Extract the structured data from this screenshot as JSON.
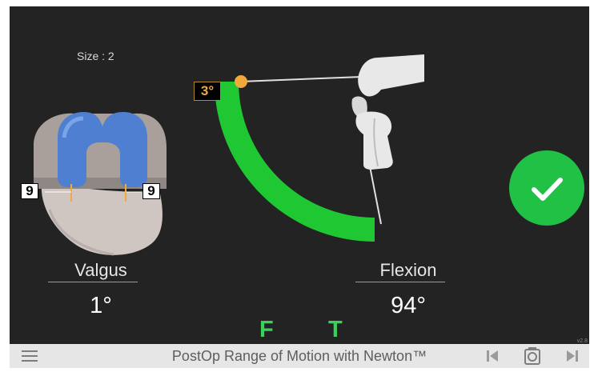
{
  "screen": {
    "size_label": "Size : 2",
    "angle_badge": "3°",
    "medial_gap": "9",
    "lateral_gap": "9",
    "valgus_label": "Valgus",
    "valgus_value": "1°",
    "flexion_label": "Flexion",
    "flexion_value": "94°",
    "femur_marker": "F",
    "tibia_marker": "T",
    "version": "v2.8"
  },
  "bottom_bar": {
    "title": "PostOp Range of Motion with Newton™"
  },
  "icons": {
    "menu": "hamburger-menu-icon",
    "prev": "skip-previous-icon",
    "camera": "camera-icon",
    "next": "skip-next-icon",
    "confirm": "checkmark-icon"
  },
  "colors": {
    "screen_bg": "#232323",
    "arc": "#1fc832",
    "confirm": "#21c146",
    "marker": "#39d35c",
    "badge_text": "#f2a93b",
    "bar_bg": "#e6e6e6"
  }
}
